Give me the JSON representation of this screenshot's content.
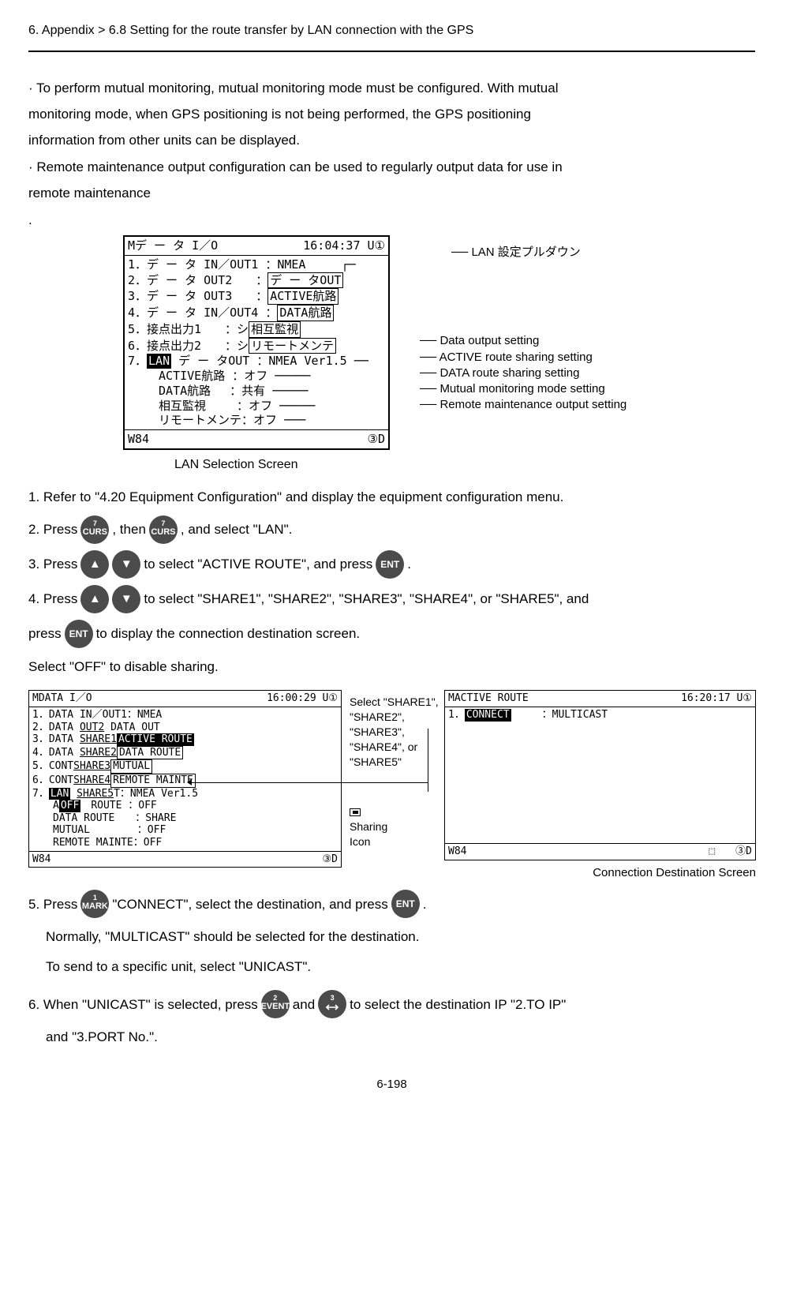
{
  "header": {
    "breadcrumb": "6. Appendix > 6.8 Setting for the route transfer by LAN connection with the GPS"
  },
  "intro": {
    "p1a": "· To perform mutual monitoring, mutual monitoring mode must be configured. With mutual",
    "p1b": "monitoring mode, when GPS positioning is not being performed, the GPS positioning",
    "p1c": "information from other units can be displayed.",
    "p2a": "· Remote maintenance output configuration can be used to regularly output data for use in",
    "p2b": "remote maintenance",
    "p2c": "."
  },
  "lan_screen": {
    "title_left": "Mデ ー タ I／O",
    "title_right": "16:04:37 U①",
    "rows": {
      "r1": "1．デ ー タ IN／OUT1 ：NMEA",
      "r2a": "2．デ ー タ OUT2　　：",
      "r2b": "デ ー タOUT",
      "r3a": "3．デ ー タ OUT3　　：",
      "r3b": "ACTIVE航路",
      "r4a": "4．デ ー タ IN／OUT4 ：",
      "r4b": "DATA航路",
      "r5a": "5．接点出力1　　：シ",
      "r5b": "相互監視",
      "r6a": "6．接点出力2　　：シ",
      "r6b": "リモートメンテ",
      "r7a": "7．",
      "r7b": "LAN",
      "r7c": " デ ー タOUT ：NMEA Ver1.5",
      "r8": "　　 ACTIVE航路 ：オフ",
      "r9": "　　 DATA航路　 ：共有",
      "r10": "　　 相互監視　　 ：オフ",
      "r11": "　　 リモートメンテ：オフ"
    },
    "foot_left": "W84",
    "foot_right": "③D",
    "callouts": {
      "top": "LAN 設定プルダウン",
      "c1": "Data output setting",
      "c2": "ACTIVE route sharing setting",
      "c3": "DATA route sharing setting",
      "c4": "Mutual monitoring mode setting",
      "c5": "Remote maintenance output setting"
    },
    "caption": "LAN Selection Screen"
  },
  "steps": {
    "s1": "1. Refer to \"4.20 Equipment Configuration\" and display the equipment configuration menu.",
    "s2a": "2. Press",
    "s2b": ", then",
    "s2c": ", and select \"LAN\".",
    "s3a": "3. Press",
    "s3b": "to select \"ACTIVE ROUTE\", and press",
    "s3c": ".",
    "s4a": "4. Press",
    "s4b": "to select \"SHARE1\", \"SHARE2\", \"SHARE3\", \"SHARE4\", or \"SHARE5\", and",
    "s4c": "press",
    "s4d": "to display the connection destination screen.",
    "s4e": "Select \"OFF\" to disable sharing.",
    "s5a": "5. Press",
    "s5b": "\"CONNECT\", select the destination, and press",
    "s5c": ".",
    "s5d": "Normally, \"MULTICAST\" should be selected for the destination.",
    "s5e": "To send to a specific unit, select \"UNICAST\".",
    "s6a": "6. When \"UNICAST\" is selected, press",
    "s6b": "and",
    "s6c": "to select the destination IP \"2.TO IP\"",
    "s6d": "and \"3.PORT No.\"."
  },
  "icons": {
    "curs_sup": "7",
    "curs": "CURS",
    "ent": "ENT",
    "mark_sup": "1",
    "mark": "MARK",
    "event_sup": "2",
    "event": "EVENT",
    "swap_sup": "3",
    "up": "▲",
    "down": "▼"
  },
  "img_a": {
    "title_left": "MDATA I／O",
    "title_right": "16:00:29 U①",
    "r1": "1．DATA IN／OUT1：NMEA",
    "r2a": "2．DATA ",
    "r2b": "OUT2",
    "r2c": "  DATA OUT",
    "r3a": "3．DATA ",
    "r3b": "SHARE1",
    "r3c": "ACTIVE ROUTE",
    "r4a": "4．DATA ",
    "r4b": "SHARE2",
    "r4c": "DATA ROUTE",
    "r5a": "5．CONT",
    "r5b": "SHARE3",
    "r5c": "MUTUAL",
    "r6a": "6．CONT",
    "r6b": "SHARE4",
    "r6c": "REMOTE MAINTE",
    "r7a": "7．",
    "r7b": "LAN",
    "r7c": " ",
    "r7d": "SHARE5",
    "r7e": "T：NMEA Ver1.5",
    "r8a": "　　A",
    "r8b": "OFF",
    "r8c": "　ROUTE ：OFF",
    "r9": "　　DATA ROUTE　　：SHARE",
    "r10": "　　MUTUAL　　　　 ：OFF",
    "r11": "　　REMOTE MAINTE：OFF",
    "foot_left": "W84",
    "foot_right": "③D",
    "side": {
      "l1": "Select \"SHARE1\",",
      "l2": "\"SHARE2\",",
      "l3": "\"SHARE3\",",
      "l4": "\"SHARE4\", or",
      "l5": "\"SHARE5\"",
      "l6": "Sharing",
      "l7": "Icon"
    }
  },
  "img_b": {
    "title_left": "MACTIVE ROUTE",
    "title_right": "16:20:17 U①",
    "r1a": "1．",
    "r1b": "CONNECT",
    "r1c": "　　　：MULTICAST",
    "foot_left": "W84",
    "foot_right": "⬚　　③D",
    "caption": "Connection Destination Screen"
  },
  "page_number": "6-198"
}
